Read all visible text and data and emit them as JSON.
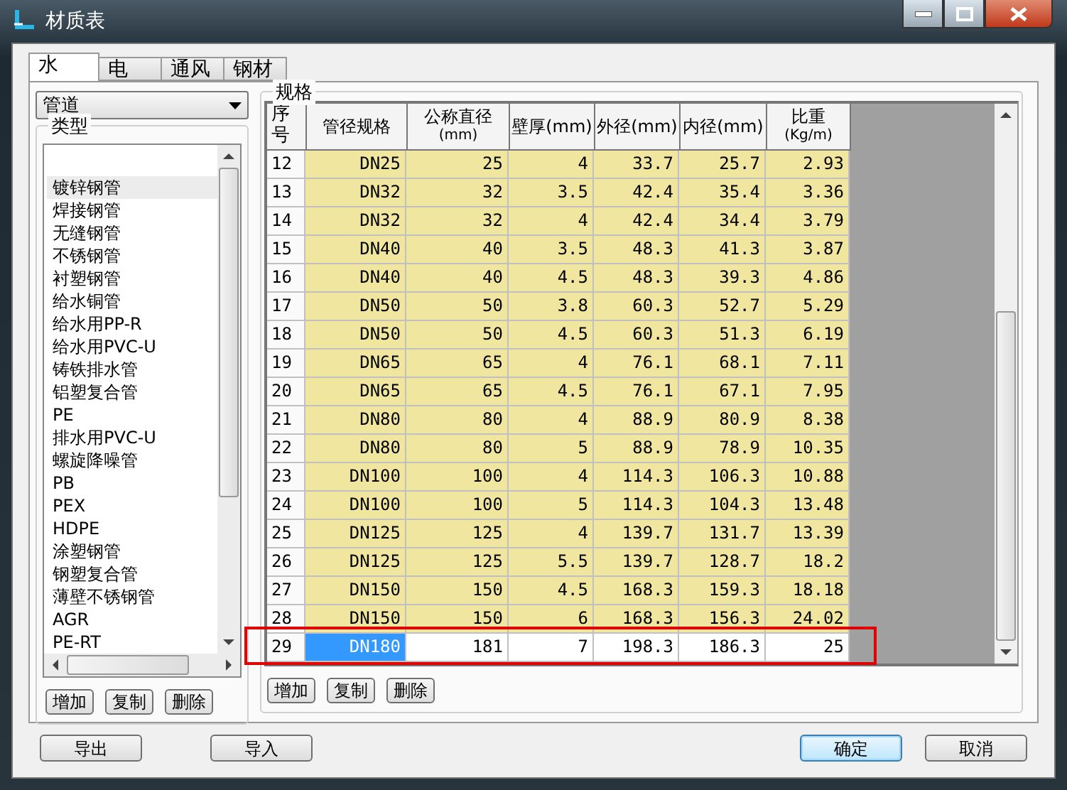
{
  "window": {
    "title": "材质表"
  },
  "tabs": [
    {
      "label": "水",
      "selected": true
    },
    {
      "label": "电",
      "selected": false
    },
    {
      "label": "通风",
      "selected": false
    },
    {
      "label": "钢材",
      "selected": false
    }
  ],
  "category_dropdown": {
    "value": "管道"
  },
  "type_group": {
    "title": "类型",
    "items": [
      {
        "label": "镀锌钢管",
        "selected": true
      },
      {
        "label": "焊接钢管",
        "selected": false
      },
      {
        "label": "无缝钢管",
        "selected": false
      },
      {
        "label": "不锈钢管",
        "selected": false
      },
      {
        "label": "衬塑钢管",
        "selected": false
      },
      {
        "label": "给水铜管",
        "selected": false
      },
      {
        "label": "给水用PP-R",
        "selected": false
      },
      {
        "label": "给水用PVC-U",
        "selected": false
      },
      {
        "label": "铸铁排水管",
        "selected": false
      },
      {
        "label": "铝塑复合管",
        "selected": false
      },
      {
        "label": "PE",
        "selected": false
      },
      {
        "label": "排水用PVC-U",
        "selected": false
      },
      {
        "label": "螺旋降噪管",
        "selected": false
      },
      {
        "label": "PB",
        "selected": false
      },
      {
        "label": "PEX",
        "selected": false
      },
      {
        "label": "HDPE",
        "selected": false
      },
      {
        "label": "涂塑钢管",
        "selected": false
      },
      {
        "label": "钢塑复合管",
        "selected": false
      },
      {
        "label": "薄壁不锈钢管",
        "selected": false
      },
      {
        "label": "AGR",
        "selected": false
      },
      {
        "label": "PE-RT",
        "selected": false
      }
    ],
    "buttons": [
      "增加",
      "复制",
      "删除"
    ]
  },
  "spec_group": {
    "title": "规格",
    "columns": [
      {
        "label": "序号"
      },
      {
        "label": "管径规格"
      },
      {
        "label": "公称直径",
        "unit": "(mm)"
      },
      {
        "label": "壁厚(mm)"
      },
      {
        "label": "外径(mm)"
      },
      {
        "label": "内径(mm)"
      },
      {
        "label": "比重",
        "unit": "(Kg/m)"
      }
    ],
    "rows": [
      {
        "cells": [
          "12",
          "DN25",
          "25",
          "4",
          "33.7",
          "25.7",
          "2.93"
        ],
        "selected": false
      },
      {
        "cells": [
          "13",
          "DN32",
          "32",
          "3.5",
          "42.4",
          "35.4",
          "3.36"
        ],
        "selected": false
      },
      {
        "cells": [
          "14",
          "DN32",
          "32",
          "4",
          "42.4",
          "34.4",
          "3.79"
        ],
        "selected": false
      },
      {
        "cells": [
          "15",
          "DN40",
          "40",
          "3.5",
          "48.3",
          "41.3",
          "3.87"
        ],
        "selected": false
      },
      {
        "cells": [
          "16",
          "DN40",
          "40",
          "4.5",
          "48.3",
          "39.3",
          "4.86"
        ],
        "selected": false
      },
      {
        "cells": [
          "17",
          "DN50",
          "50",
          "3.8",
          "60.3",
          "52.7",
          "5.29"
        ],
        "selected": false
      },
      {
        "cells": [
          "18",
          "DN50",
          "50",
          "4.5",
          "60.3",
          "51.3",
          "6.19"
        ],
        "selected": false
      },
      {
        "cells": [
          "19",
          "DN65",
          "65",
          "4",
          "76.1",
          "68.1",
          "7.11"
        ],
        "selected": false
      },
      {
        "cells": [
          "20",
          "DN65",
          "65",
          "4.5",
          "76.1",
          "67.1",
          "7.95"
        ],
        "selected": false
      },
      {
        "cells": [
          "21",
          "DN80",
          "80",
          "4",
          "88.9",
          "80.9",
          "8.38"
        ],
        "selected": false
      },
      {
        "cells": [
          "22",
          "DN80",
          "80",
          "5",
          "88.9",
          "78.9",
          "10.35"
        ],
        "selected": false
      },
      {
        "cells": [
          "23",
          "DN100",
          "100",
          "4",
          "114.3",
          "106.3",
          "10.88"
        ],
        "selected": false
      },
      {
        "cells": [
          "24",
          "DN100",
          "100",
          "5",
          "114.3",
          "104.3",
          "13.48"
        ],
        "selected": false
      },
      {
        "cells": [
          "25",
          "DN125",
          "125",
          "4",
          "139.7",
          "131.7",
          "13.39"
        ],
        "selected": false
      },
      {
        "cells": [
          "26",
          "DN125",
          "125",
          "5.5",
          "139.7",
          "128.7",
          "18.2"
        ],
        "selected": false
      },
      {
        "cells": [
          "27",
          "DN150",
          "150",
          "4.5",
          "168.3",
          "159.3",
          "18.18"
        ],
        "selected": false
      },
      {
        "cells": [
          "28",
          "DN150",
          "150",
          "6",
          "168.3",
          "156.3",
          "24.02"
        ],
        "selected": false
      },
      {
        "cells": [
          "29",
          "DN180",
          "181",
          "7",
          "198.3",
          "186.3",
          "25"
        ],
        "selected": true
      }
    ],
    "buttons": [
      "增加",
      "复制",
      "删除"
    ]
  },
  "footer": {
    "left_buttons": [
      "导出",
      "导入"
    ],
    "right_buttons": [
      {
        "label": "确定",
        "selected": true
      },
      {
        "label": "取消",
        "selected": false
      }
    ]
  }
}
